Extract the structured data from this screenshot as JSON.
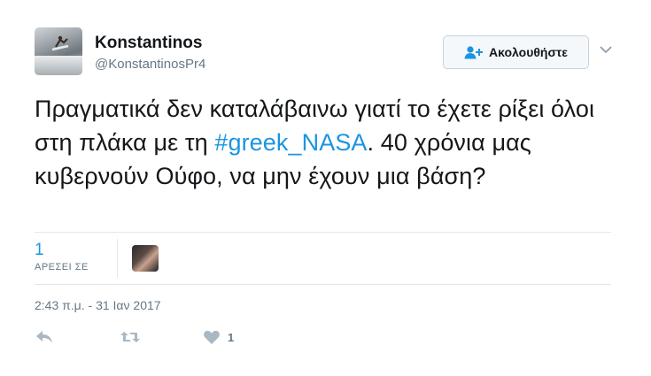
{
  "tweet": {
    "author_name": "Konstantinos",
    "author_handle": "@KonstantinosPr4",
    "follow_label": "Ακολουθήστε",
    "text_part1": "Πραγματικά δεν καταλάβαινω γιατί το έχετε ρίξει όλοι στη πλάκα με τη ",
    "hashtag": "#greek_NASA",
    "text_part2": ". 40 χρόνια μας κυβερνούν Ούφο, να μην έχουν μια βάση?",
    "likes_count": "1",
    "likes_label": "ΑΡΕΣΕΙ ΣΕ",
    "timestamp": "2:43 π.μ. - 31 Ιαν 2017",
    "action_like_count": "1"
  },
  "icons": {
    "follow": "add-user-icon",
    "more": "chevron-down-icon",
    "reply": "reply-icon",
    "retweet": "retweet-icon",
    "like": "heart-icon"
  },
  "colors": {
    "link": "#1b95e0",
    "secondary_text": "#657786",
    "border": "#e1e8ed"
  }
}
